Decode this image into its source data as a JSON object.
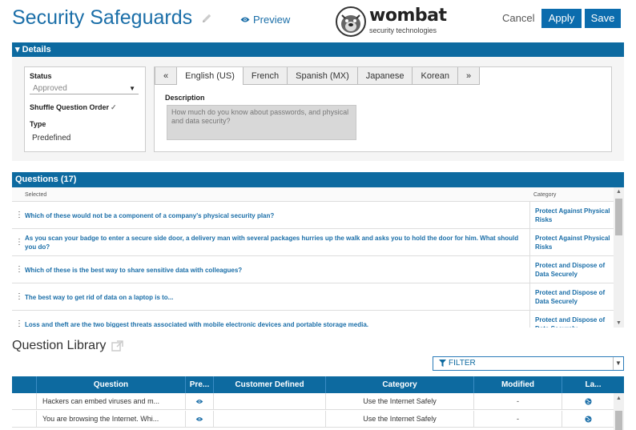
{
  "header": {
    "title": "Security Safeguards",
    "preview_label": "Preview",
    "logo_word": "wombat",
    "logo_sub": "security technologies",
    "cancel_label": "Cancel",
    "apply_label": "Apply",
    "save_label": "Save"
  },
  "details": {
    "bar_label": "▾ Details",
    "status_label": "Status",
    "status_value": "Approved",
    "shuffle_label": "Shuffle Question Order",
    "type_label": "Type",
    "type_value": "Predefined",
    "tabs": [
      "«",
      "English (US)",
      "French",
      "Spanish (MX)",
      "Japanese",
      "Korean",
      "»"
    ],
    "active_tab": "English (US)",
    "description_label": "Description",
    "description_value": "How much do you know about passwords, and physical and data security?"
  },
  "questions": {
    "bar_label": "Questions (17)",
    "col_selected": "Selected",
    "col_category": "Category",
    "rows": [
      {
        "text": "Which of these would not be a component of a company's physical security plan?",
        "category": "Protect Against Physical Risks"
      },
      {
        "text": "As you scan your badge to enter a secure side door, a delivery man with several packages hurries up the walk and asks you to hold the door for him. What should you do?",
        "category": "Protect Against Physical Risks"
      },
      {
        "text": "Which of these is the best way to share sensitive data with colleagues?",
        "category": "Protect and Dispose of Data Securely"
      },
      {
        "text": "The best way to get rid of data on a laptop is to...",
        "category": "Protect and Dispose of Data Securely"
      },
      {
        "text": "Loss and theft are the two biggest threats associated with mobile electronic devices and portable storage media.",
        "category": "Protect and Dispose of Data Securely"
      }
    ]
  },
  "library": {
    "title": "Question Library",
    "filter_label": "FILTER",
    "columns": [
      "Question",
      "Pre...",
      "Customer Defined",
      "Category",
      "Modified",
      "La..."
    ],
    "rows": [
      {
        "question": "Hackers can embed viruses and m...",
        "category": "Use the Internet Safely",
        "modified": "-"
      },
      {
        "question": "You are browsing the Internet. Whi...",
        "category": "Use the Internet Safely",
        "modified": "-"
      }
    ]
  },
  "colors": {
    "brand_blue": "#0d6aa0",
    "link_blue": "#1a6ea8"
  }
}
